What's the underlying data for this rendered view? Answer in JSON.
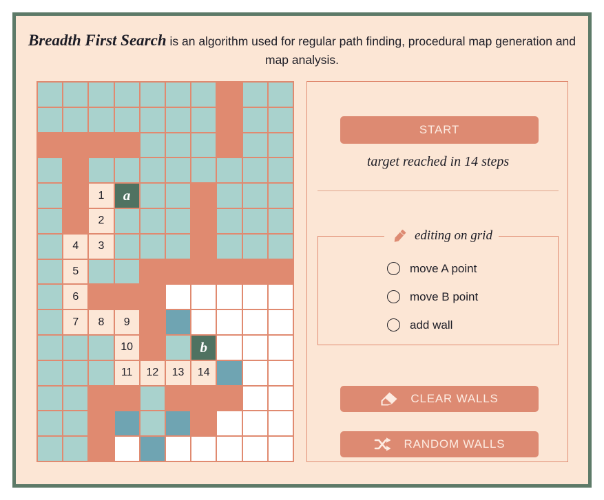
{
  "header": {
    "title": "Breadth First Search",
    "tagline": " is an algorithm used for regular path finding, procedural map generation and map analysis."
  },
  "colors": {
    "frame_border": "#5d7a68",
    "background": "#fce6d5",
    "wall": "#e08a70",
    "open": "#a9d2cd",
    "unvisited": "#ffffff",
    "path": "#fce7d7",
    "frontier": "#6fa4b2",
    "endpoint": "#4f7261",
    "button": "#dd8a72",
    "button_text": "#fdece2"
  },
  "controls": {
    "start_label": "START",
    "status": "target reached in 14 steps",
    "edit_legend": "editing on grid",
    "pencil_icon": "pencil-icon",
    "radios": [
      {
        "label": "move A point",
        "selected": false
      },
      {
        "label": "move B point",
        "selected": false
      },
      {
        "label": "add wall",
        "selected": false
      }
    ],
    "clear_walls_label": "CLEAR WALLS",
    "clear_walls_icon": "eraser-icon",
    "random_walls_label": "RANDOM WALLS",
    "random_walls_icon": "shuffle-icon"
  },
  "grid": {
    "columns": 10,
    "rows": 15,
    "legend": {
      "open": "unexplored open cell",
      "wall": "wall",
      "unvisited": "not reached",
      "path": "path step",
      "frontier": "frontier cell",
      "endpoint": "start/target endpoint"
    },
    "start_label": "a",
    "target_label": "b",
    "steps": 14,
    "cells": [
      [
        {
          "t": "open"
        },
        {
          "t": "open"
        },
        {
          "t": "open"
        },
        {
          "t": "open"
        },
        {
          "t": "open"
        },
        {
          "t": "open"
        },
        {
          "t": "open"
        },
        {
          "t": "wall"
        },
        {
          "t": "open"
        },
        {
          "t": "open"
        }
      ],
      [
        {
          "t": "open"
        },
        {
          "t": "open"
        },
        {
          "t": "open"
        },
        {
          "t": "open"
        },
        {
          "t": "open"
        },
        {
          "t": "open"
        },
        {
          "t": "open"
        },
        {
          "t": "wall"
        },
        {
          "t": "open"
        },
        {
          "t": "open"
        }
      ],
      [
        {
          "t": "wall"
        },
        {
          "t": "wall"
        },
        {
          "t": "wall"
        },
        {
          "t": "wall"
        },
        {
          "t": "open"
        },
        {
          "t": "open"
        },
        {
          "t": "open"
        },
        {
          "t": "wall"
        },
        {
          "t": "open"
        },
        {
          "t": "open"
        }
      ],
      [
        {
          "t": "open"
        },
        {
          "t": "wall"
        },
        {
          "t": "open"
        },
        {
          "t": "open"
        },
        {
          "t": "open"
        },
        {
          "t": "open"
        },
        {
          "t": "open"
        },
        {
          "t": "open"
        },
        {
          "t": "open"
        },
        {
          "t": "open"
        }
      ],
      [
        {
          "t": "open"
        },
        {
          "t": "wall"
        },
        {
          "t": "path",
          "v": "1"
        },
        {
          "t": "endpoint",
          "v": "a"
        },
        {
          "t": "open"
        },
        {
          "t": "open"
        },
        {
          "t": "wall"
        },
        {
          "t": "open"
        },
        {
          "t": "open"
        },
        {
          "t": "open"
        }
      ],
      [
        {
          "t": "open"
        },
        {
          "t": "wall"
        },
        {
          "t": "path",
          "v": "2"
        },
        {
          "t": "open"
        },
        {
          "t": "open"
        },
        {
          "t": "open"
        },
        {
          "t": "wall"
        },
        {
          "t": "open"
        },
        {
          "t": "open"
        },
        {
          "t": "open"
        }
      ],
      [
        {
          "t": "open"
        },
        {
          "t": "path",
          "v": "4"
        },
        {
          "t": "path",
          "v": "3"
        },
        {
          "t": "open"
        },
        {
          "t": "open"
        },
        {
          "t": "open"
        },
        {
          "t": "wall"
        },
        {
          "t": "open"
        },
        {
          "t": "open"
        },
        {
          "t": "open"
        }
      ],
      [
        {
          "t": "open"
        },
        {
          "t": "path",
          "v": "5"
        },
        {
          "t": "open"
        },
        {
          "t": "open"
        },
        {
          "t": "wall"
        },
        {
          "t": "wall"
        },
        {
          "t": "wall"
        },
        {
          "t": "wall"
        },
        {
          "t": "wall"
        },
        {
          "t": "wall"
        }
      ],
      [
        {
          "t": "open"
        },
        {
          "t": "path",
          "v": "6"
        },
        {
          "t": "wall"
        },
        {
          "t": "wall"
        },
        {
          "t": "wall"
        },
        {
          "t": "unvisited"
        },
        {
          "t": "unvisited"
        },
        {
          "t": "unvisited"
        },
        {
          "t": "unvisited"
        },
        {
          "t": "unvisited"
        }
      ],
      [
        {
          "t": "open"
        },
        {
          "t": "path",
          "v": "7"
        },
        {
          "t": "path",
          "v": "8"
        },
        {
          "t": "path",
          "v": "9"
        },
        {
          "t": "wall"
        },
        {
          "t": "frontier"
        },
        {
          "t": "unvisited"
        },
        {
          "t": "unvisited"
        },
        {
          "t": "unvisited"
        },
        {
          "t": "unvisited"
        }
      ],
      [
        {
          "t": "open"
        },
        {
          "t": "open"
        },
        {
          "t": "open"
        },
        {
          "t": "path",
          "v": "10"
        },
        {
          "t": "wall"
        },
        {
          "t": "open"
        },
        {
          "t": "endpoint",
          "v": "b"
        },
        {
          "t": "unvisited"
        },
        {
          "t": "unvisited"
        },
        {
          "t": "unvisited"
        }
      ],
      [
        {
          "t": "open"
        },
        {
          "t": "open"
        },
        {
          "t": "open"
        },
        {
          "t": "path",
          "v": "11"
        },
        {
          "t": "path",
          "v": "12"
        },
        {
          "t": "path",
          "v": "13"
        },
        {
          "t": "path",
          "v": "14"
        },
        {
          "t": "frontier"
        },
        {
          "t": "unvisited"
        },
        {
          "t": "unvisited"
        }
      ],
      [
        {
          "t": "open"
        },
        {
          "t": "open"
        },
        {
          "t": "wall"
        },
        {
          "t": "wall"
        },
        {
          "t": "open"
        },
        {
          "t": "wall"
        },
        {
          "t": "wall"
        },
        {
          "t": "wall"
        },
        {
          "t": "unvisited"
        },
        {
          "t": "unvisited"
        }
      ],
      [
        {
          "t": "open"
        },
        {
          "t": "open"
        },
        {
          "t": "wall"
        },
        {
          "t": "frontier"
        },
        {
          "t": "open"
        },
        {
          "t": "frontier"
        },
        {
          "t": "wall"
        },
        {
          "t": "unvisited"
        },
        {
          "t": "unvisited"
        },
        {
          "t": "unvisited"
        }
      ],
      [
        {
          "t": "open"
        },
        {
          "t": "open"
        },
        {
          "t": "wall"
        },
        {
          "t": "unvisited"
        },
        {
          "t": "frontier"
        },
        {
          "t": "unvisited"
        },
        {
          "t": "unvisited"
        },
        {
          "t": "unvisited"
        },
        {
          "t": "unvisited"
        },
        {
          "t": "unvisited"
        }
      ]
    ]
  }
}
